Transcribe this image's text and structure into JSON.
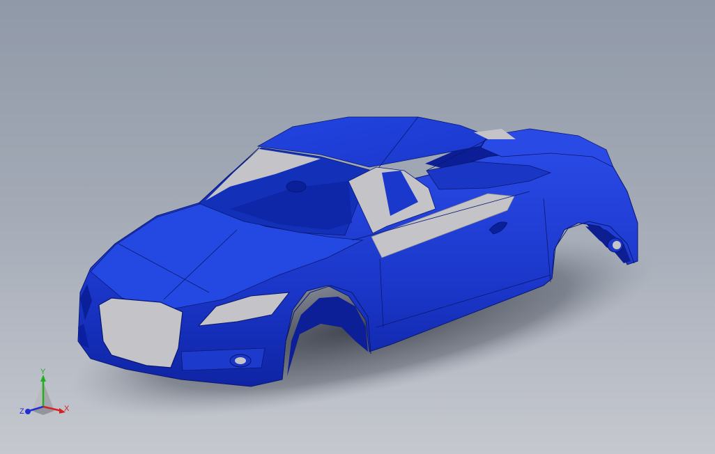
{
  "colors": {
    "body_main": "#1f3fd6",
    "body_dark": "#0b1f9e",
    "body_light": "#3354e8",
    "glass": "#c4c4c8",
    "edge": "#0a1870",
    "axis_x": "#d42020",
    "axis_y": "#20b020",
    "axis_z": "#2030d0"
  },
  "triad": {
    "x_label": "X",
    "y_label": "Y",
    "z_label": "Z"
  }
}
